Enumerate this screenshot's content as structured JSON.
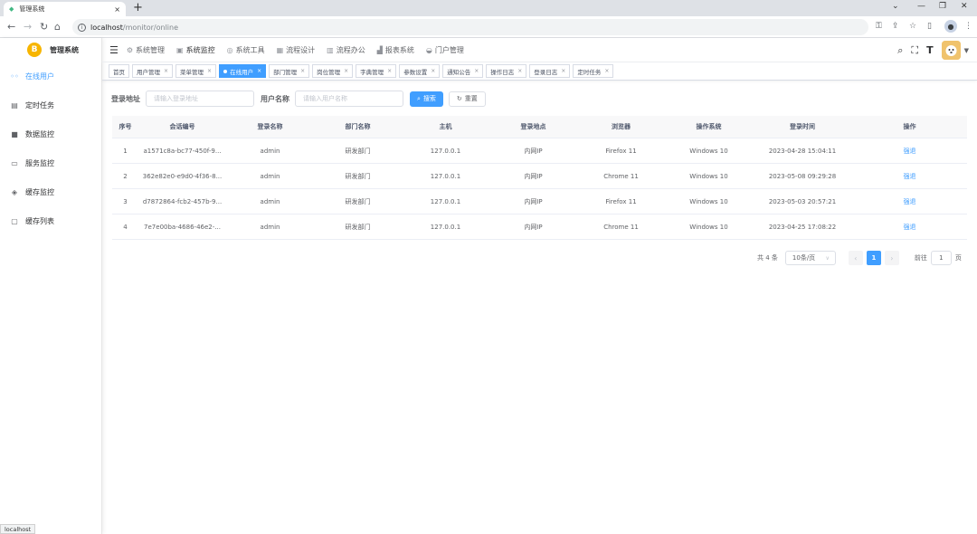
{
  "browser": {
    "tab_title": "管理系统",
    "tab_close": "×",
    "new_tab": "+",
    "url_host": "localhost",
    "url_path": "/monitor/online",
    "status_url": "localhost"
  },
  "app": {
    "logo_letter": "B",
    "title": "管理系统"
  },
  "sidebar": {
    "items": [
      {
        "label": "在线用户",
        "icon": "online-icon",
        "active": true
      },
      {
        "label": "定时任务",
        "icon": "job-icon"
      },
      {
        "label": "数据监控",
        "icon": "druid-icon"
      },
      {
        "label": "服务监控",
        "icon": "server-icon"
      },
      {
        "label": "缓存监控",
        "icon": "redis-icon"
      },
      {
        "label": "缓存列表",
        "icon": "redis-list-icon"
      }
    ]
  },
  "topnav": {
    "items": [
      {
        "label": "系统管理",
        "icon": "gear-icon"
      },
      {
        "label": "系统监控",
        "icon": "monitor-icon",
        "active": true
      },
      {
        "label": "系统工具",
        "icon": "tool-icon"
      },
      {
        "label": "流程设计",
        "icon": "flow-icon"
      },
      {
        "label": "流程办公",
        "icon": "office-icon"
      },
      {
        "label": "报表系统",
        "icon": "chart-icon"
      },
      {
        "label": "门户管理",
        "icon": "portal-icon"
      }
    ]
  },
  "tags": [
    {
      "label": "首页",
      "closable": false
    },
    {
      "label": "用户管理",
      "closable": true
    },
    {
      "label": "菜单管理",
      "closable": true
    },
    {
      "label": "在线用户",
      "closable": true,
      "active": true
    },
    {
      "label": "部门管理",
      "closable": true
    },
    {
      "label": "岗位管理",
      "closable": true
    },
    {
      "label": "字典管理",
      "closable": true
    },
    {
      "label": "参数设置",
      "closable": true
    },
    {
      "label": "通知公告",
      "closable": true
    },
    {
      "label": "操作日志",
      "closable": true
    },
    {
      "label": "登录日志",
      "closable": true
    },
    {
      "label": "定时任务",
      "closable": true
    }
  ],
  "search": {
    "ipaddr_label": "登录地址",
    "ipaddr_placeholder": "请输入登录地址",
    "user_label": "用户名称",
    "user_placeholder": "请输入用户名称",
    "search_button": "搜索",
    "reset_button": "重置"
  },
  "table": {
    "headers": [
      "序号",
      "会话编号",
      "登录名称",
      "部门名称",
      "主机",
      "登录地点",
      "浏览器",
      "操作系统",
      "登录时间",
      "操作"
    ],
    "rows": [
      [
        "1",
        "a1571c8a-bc77-450f-9...",
        "admin",
        "研发部门",
        "127.0.0.1",
        "内网IP",
        "Firefox 11",
        "Windows 10",
        "2023-04-28 15:04:11",
        "强退"
      ],
      [
        "2",
        "362e82e0-e9d0-4f36-8...",
        "admin",
        "研发部门",
        "127.0.0.1",
        "内网IP",
        "Chrome 11",
        "Windows 10",
        "2023-05-08 09:29:28",
        "强退"
      ],
      [
        "3",
        "d7872864-fcb2-457b-9...",
        "admin",
        "研发部门",
        "127.0.0.1",
        "内网IP",
        "Firefox 11",
        "Windows 10",
        "2023-05-03 20:57:21",
        "强退"
      ],
      [
        "4",
        "7e7e00ba-4686-46e2-...",
        "admin",
        "研发部门",
        "127.0.0.1",
        "内网IP",
        "Chrome 11",
        "Windows 10",
        "2023-04-25 17:08:22",
        "强退"
      ]
    ]
  },
  "pagination": {
    "total": "共 4 条",
    "page_size": "10条/页",
    "prev": "‹",
    "current": "1",
    "next": "›",
    "goto_label": "前往",
    "goto_value": "1",
    "goto_suffix": "页"
  },
  "colors": {
    "accent": "#409eff",
    "logo": "#f7b500"
  }
}
